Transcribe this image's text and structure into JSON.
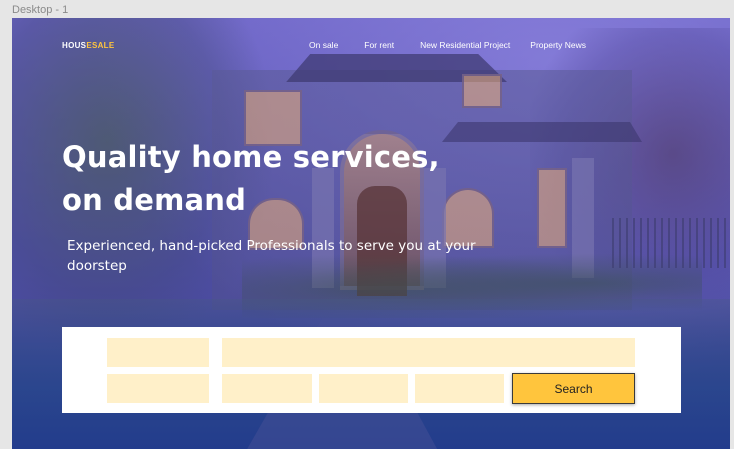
{
  "canvas": {
    "frame_label": "Desktop - 1"
  },
  "brand": {
    "logo_part1": "HOUS",
    "logo_part2": "ESALE",
    "accent_color": "#ffc53d"
  },
  "nav": {
    "items": [
      {
        "label": "On sale"
      },
      {
        "label": "For rent"
      },
      {
        "label": "New Residential Project"
      },
      {
        "label": "Property News"
      }
    ]
  },
  "hero": {
    "title": "Quality home services, on demand",
    "subtitle": "Experienced, hand-picked Professionals to serve you at your doorstep",
    "overlay_color": "#5a56b6"
  },
  "search": {
    "button_label": "Search",
    "button_color": "#ffc53d",
    "field_color": "#fff0c9"
  }
}
